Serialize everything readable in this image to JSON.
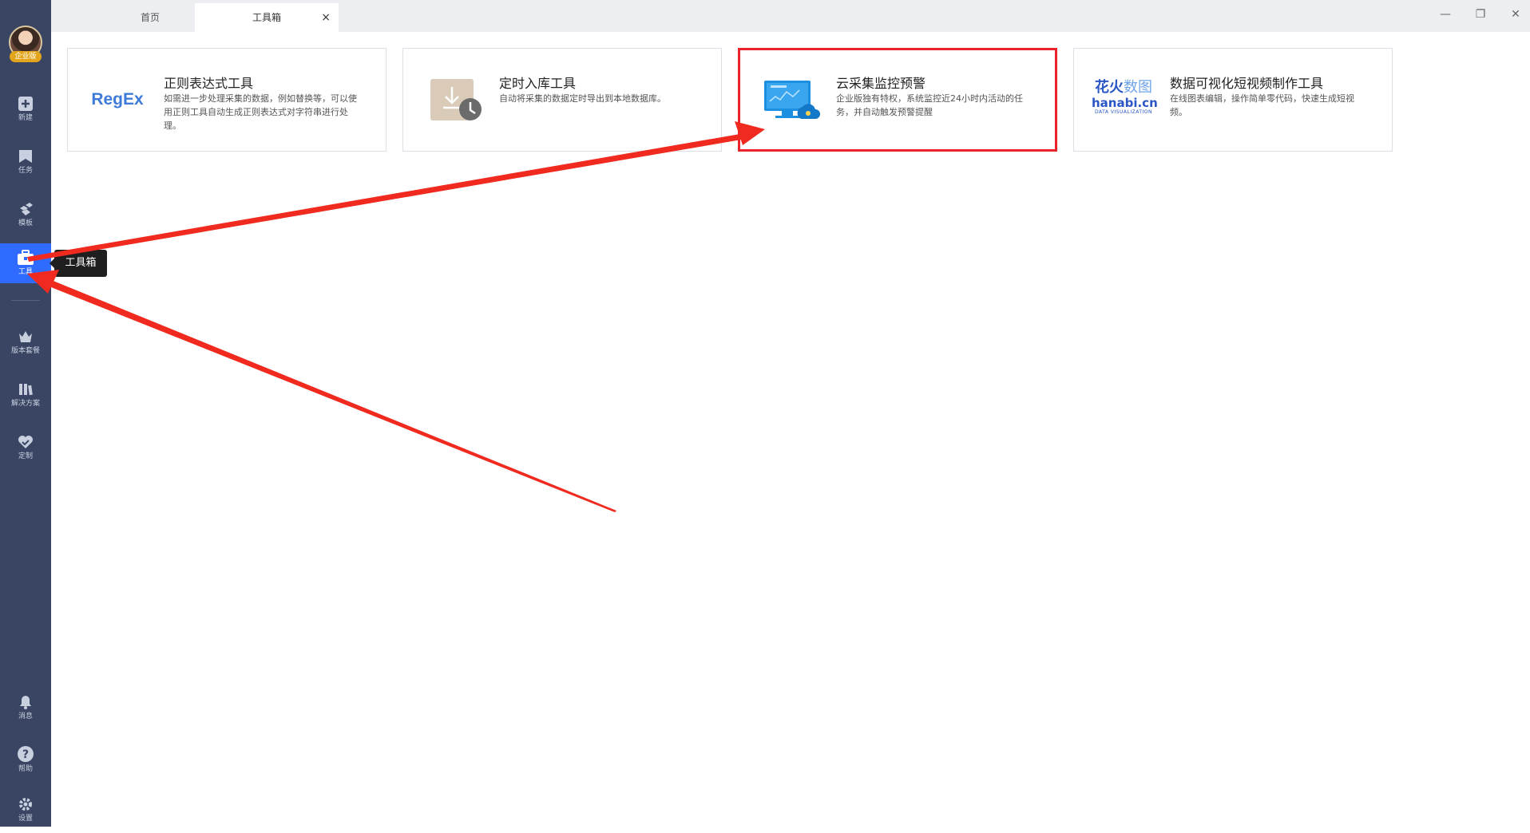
{
  "sidebar": {
    "avatar_badge": "企业版",
    "items": [
      {
        "label": "新建",
        "icon": "plus-square-icon"
      },
      {
        "label": "任务",
        "icon": "bookmark-icon"
      },
      {
        "label": "模板",
        "icon": "cubes-icon"
      },
      {
        "label": "工具",
        "icon": "toolbox-icon"
      },
      {
        "label": "版本套餐",
        "icon": "crown-icon"
      },
      {
        "label": "解决方案",
        "icon": "book-stack-icon"
      },
      {
        "label": "定制",
        "icon": "heart-check-icon"
      },
      {
        "label": "消息",
        "icon": "bell-icon"
      },
      {
        "label": "帮助",
        "icon": "question-circle-icon"
      },
      {
        "label": "设置",
        "icon": "gear-icon"
      }
    ],
    "active_index": 3,
    "tooltip": "工具箱",
    "active_color": "#2f6bff",
    "bg_color": "#3a4563"
  },
  "tabs": [
    {
      "label": "首页"
    },
    {
      "label": "工具箱",
      "close": "×"
    }
  ],
  "window_controls": {
    "minimize": "—",
    "restore": "❐",
    "close": "✕"
  },
  "cards": [
    {
      "icon": "regex-logo",
      "logo_text": "RegEx",
      "title": "正则表达式工具",
      "desc": "如需进一步处理采集的数据，例如替换等，可以使用正则工具自动生成正则表达式对字符串进行处理。"
    },
    {
      "icon": "download-clock-icon",
      "title": "定时入库工具",
      "desc": "自动将采集的数据定时导出到本地数据库。"
    },
    {
      "icon": "monitor-cloud-icon",
      "title": "云采集监控预警",
      "desc": "企业版独有特权，系统监控近24小时内活动的任务，并自动触发预警提醒"
    },
    {
      "icon": "hanabi-logo",
      "logo_line1": "花火",
      "logo_line1b": "数图",
      "logo_line2": "hanabi.cn",
      "logo_sub": "DATA VISUALIZATION",
      "title": "数据可视化短视频制作工具",
      "desc": "在线图表编辑，操作简单零代码，快速生成短视频。"
    }
  ],
  "highlight_color": "#e8242a"
}
